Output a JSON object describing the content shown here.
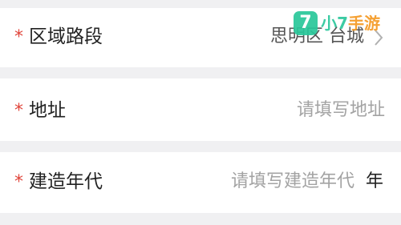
{
  "form": {
    "district": {
      "required_mark": "*",
      "label": "区域路段",
      "value": "思明区 台城"
    },
    "address": {
      "required_mark": "*",
      "label": "地址",
      "placeholder": "请填写地址"
    },
    "year": {
      "required_mark": "*",
      "label": "建造年代",
      "placeholder": "请填写建造年代",
      "unit": "年"
    }
  },
  "watermark": {
    "badge": "7",
    "text_main": "小7",
    "text_accent": "手游"
  },
  "colors": {
    "required": "#e0443a",
    "background": "#f0f0f2",
    "placeholder": "#a3a3a3",
    "watermark_green": "#29c79a",
    "watermark_orange": "#f59a23"
  }
}
